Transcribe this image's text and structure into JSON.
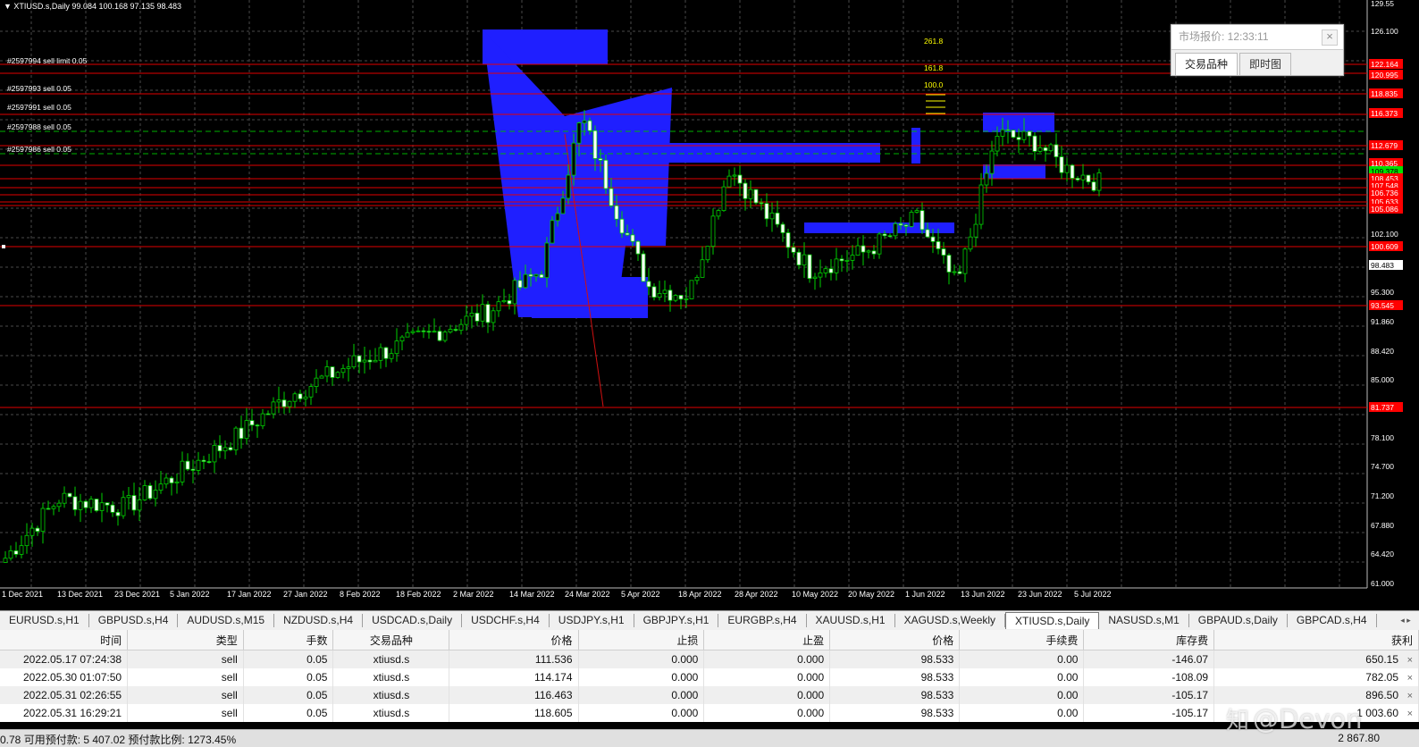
{
  "chart": {
    "symbol_title": "XTIUSD.s,Daily   99.084 100.168 97.135 98.483",
    "price_labels": [
      "129.55",
      "126.100",
      "122.164",
      "120.995",
      "118.835",
      "116.373",
      "112.679",
      "110.365",
      "109.378",
      "108.453",
      "107.548",
      "106.736",
      "105.633",
      "105.086",
      "102.100",
      "100.609",
      "98.483",
      "95.300",
      "93.545",
      "91.860",
      "88.420",
      "85.000",
      "81.737",
      "78.100",
      "74.700",
      "71.200",
      "67.880",
      "64.420",
      "61.000"
    ],
    "price_label_colors": {
      "red": "#ff0000",
      "green": "#00e000",
      "white": "#ffffff"
    },
    "date_labels": [
      "1 Dec 2021",
      "13 Dec 2021",
      "23 Dec 2021",
      "5 Jan 2022",
      "17 Jan 2022",
      "27 Jan 2022",
      "8 Feb 2022",
      "18 Feb 2022",
      "2 Mar 2022",
      "14 Mar 2022",
      "24 Mar 2022",
      "5 Apr 2022",
      "18 Apr 2022",
      "28 Apr 2022",
      "10 May 2022",
      "20 May 2022",
      "1 Jun 2022",
      "13 Jun 2022",
      "23 Jun 2022",
      "5 Jul 2022"
    ],
    "order_labels": [
      "#2597994 sell limit 0.05",
      "#2597993 sell 0.05",
      "#2597991 sell 0.05",
      "#2597988 sell 0.05",
      "#2597986 sell 0.05"
    ],
    "fib_labels": [
      "261.8",
      "161.8",
      "100.0"
    ]
  },
  "market_watch": {
    "title": "市场报价: 12:33:11",
    "close_icon": "close-icon",
    "tabs": [
      "交易品种",
      "即时图"
    ]
  },
  "symbol_tabs": [
    "EURUSD.s,H1",
    "GBPUSD.s,H4",
    "AUDUSD.s,M15",
    "NZDUSD.s,H4",
    "USDCAD.s,Daily",
    "USDCHF.s,H4",
    "USDJPY.s,H1",
    "GBPJPY.s,H1",
    "EURGBP.s,H4",
    "XAUUSD.s,H1",
    "XAGUSD.s,Weekly",
    "XTIUSD.s,Daily",
    "NASUSD.s,M1",
    "GBPAUD.s,Daily",
    "GBPCAD.s,H4"
  ],
  "active_symbol_tab": "XTIUSD.s,Daily",
  "tab_scroll_arrows": "◂ ▸",
  "trades": {
    "columns": [
      "时间",
      "类型",
      "手数",
      "交易品种",
      "价格",
      "止损",
      "止盈",
      "价格",
      "手续费",
      "库存费",
      "获利"
    ],
    "rows": [
      [
        "2022.05.17 07:24:38",
        "sell",
        "0.05",
        "xtiusd.s",
        "111.536",
        "0.000",
        "0.000",
        "98.533",
        "0.00",
        "-146.07",
        "650.15"
      ],
      [
        "2022.05.30 01:07:50",
        "sell",
        "0.05",
        "xtiusd.s",
        "114.174",
        "0.000",
        "0.000",
        "98.533",
        "0.00",
        "-108.09",
        "782.05"
      ],
      [
        "2022.05.31 02:26:55",
        "sell",
        "0.05",
        "xtiusd.s",
        "116.463",
        "0.000",
        "0.000",
        "98.533",
        "0.00",
        "-105.17",
        "896.50"
      ],
      [
        "2022.05.31 16:29:21",
        "sell",
        "0.05",
        "xtiusd.s",
        "118.605",
        "0.000",
        "0.000",
        "98.533",
        "0.00",
        "-105.17",
        "1 003.60"
      ]
    ],
    "row_close_icon": "×"
  },
  "footer": {
    "left": "0.78  可用预付款: 5 407.02  预付款比例: 1273.45%",
    "right": "2 867.80"
  },
  "watermark": {
    "icon": "知",
    "text": "@Devon"
  }
}
